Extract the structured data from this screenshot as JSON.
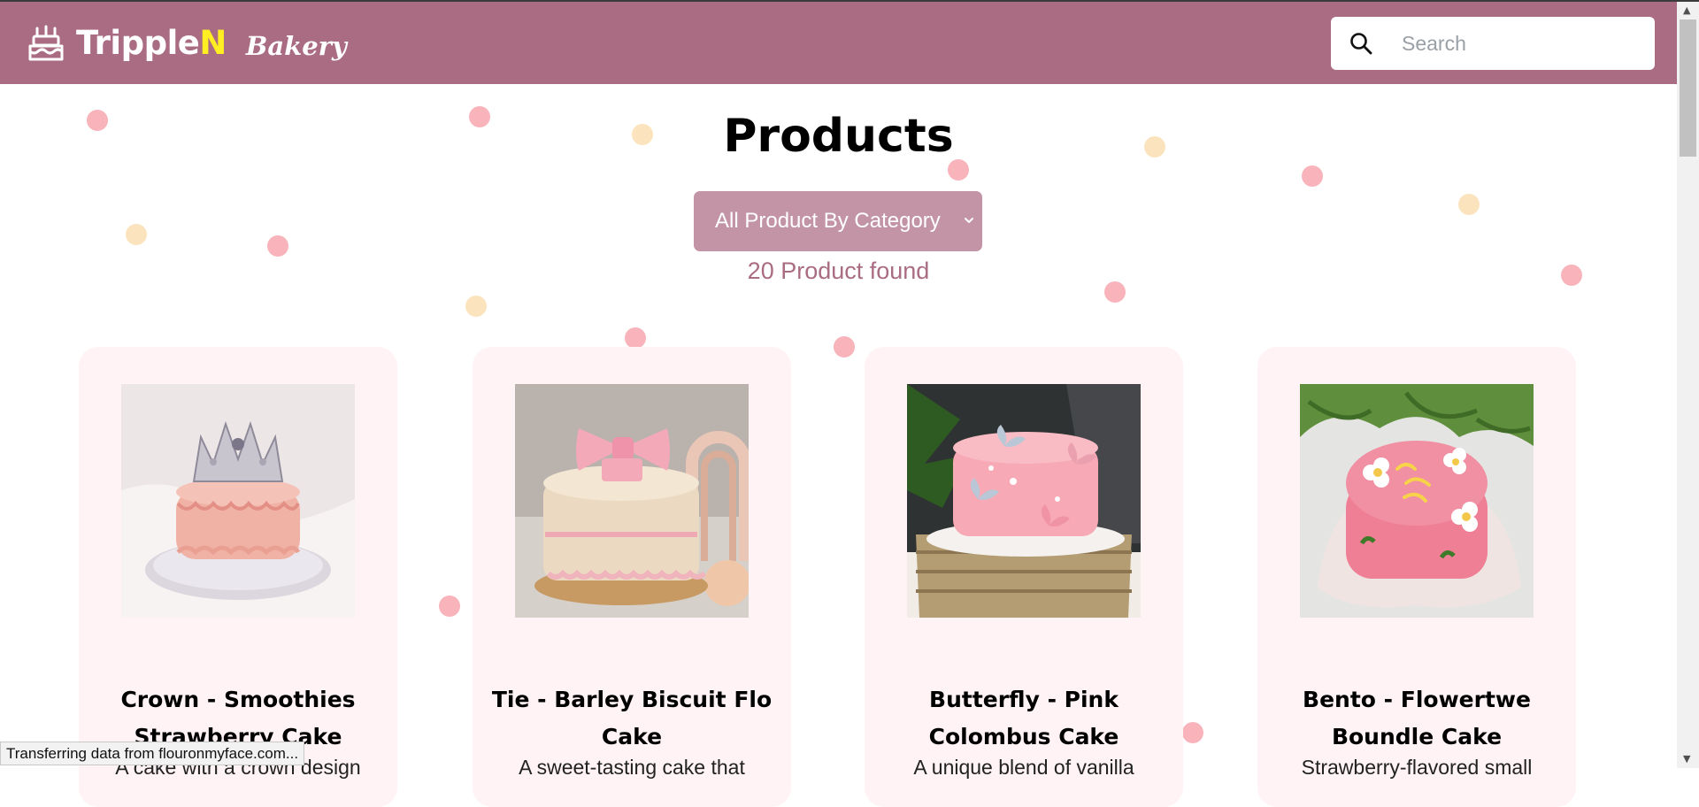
{
  "header": {
    "brand_main": "Tripple",
    "brand_accent": "N",
    "brand_sub": "Bakery",
    "search_placeholder": "Search",
    "logo_icon": "cake-icon",
    "search_icon": "search-icon"
  },
  "main": {
    "title": "Products",
    "category_select": "All Product By Category",
    "product_count": "20 Product found"
  },
  "products": [
    {
      "name": "Crown - Smoothies Strawberry Cake",
      "desc": "A cake with a crown design"
    },
    {
      "name": "Tie - Barley Biscuit Flo Cake",
      "desc": "A sweet-tasting cake that"
    },
    {
      "name": "Butterfly - Pink Colombus Cake",
      "desc": "A unique blend of vanilla"
    },
    {
      "name": "Bento - Flowertwe Boundle Cake",
      "desc": "Strawberry-flavored small"
    }
  ],
  "status_bar": "Transferring data from flouronmyface.com...",
  "colors": {
    "navbar": "#aa6c83",
    "brand_accent": "#ffee22",
    "select_bg": "#c294a6",
    "count_text": "#aa6c83",
    "card_bg": "#fff3f5"
  }
}
